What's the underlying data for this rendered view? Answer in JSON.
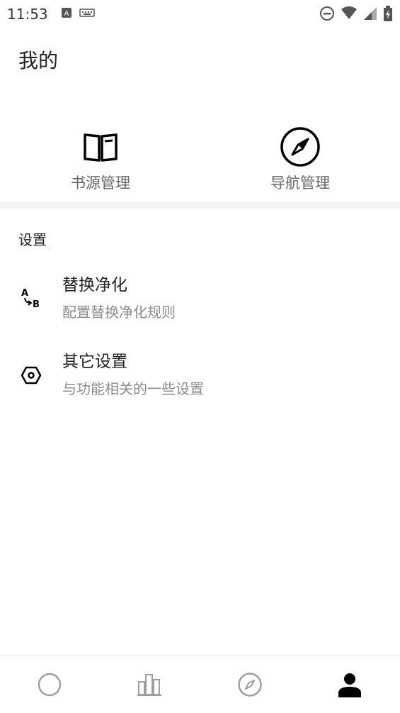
{
  "status_bar": {
    "time": "11:53",
    "left_icons": [
      "notification-a-icon",
      "keyboard-icon"
    ],
    "right_icons": [
      "do-not-disturb-icon",
      "wifi-icon",
      "signal-icon",
      "battery-charging-icon"
    ]
  },
  "app_bar": {
    "title": "我的"
  },
  "quick_actions": [
    {
      "label": "书源管理",
      "icon": "book-icon"
    },
    {
      "label": "导航管理",
      "icon": "compass-icon"
    }
  ],
  "settings": {
    "section_title": "设置",
    "items": [
      {
        "title": "替换净化",
        "subtitle": "配置替换净化规则",
        "icon": "replace-icon"
      },
      {
        "title": "其它设置",
        "subtitle": "与功能相关的一些设置",
        "icon": "settings-hexagon-icon"
      }
    ]
  },
  "bottom_nav": {
    "items": [
      {
        "icon": "circle-icon",
        "selected": false
      },
      {
        "icon": "bookshelf-icon",
        "selected": false
      },
      {
        "icon": "compass-icon",
        "selected": false
      },
      {
        "icon": "person-icon",
        "selected": true
      }
    ]
  },
  "colors": {
    "primary_text": "#222222",
    "secondary_text": "#8c8c8c",
    "icon": "#000000",
    "inactive_icon": "#9e9e9e"
  }
}
